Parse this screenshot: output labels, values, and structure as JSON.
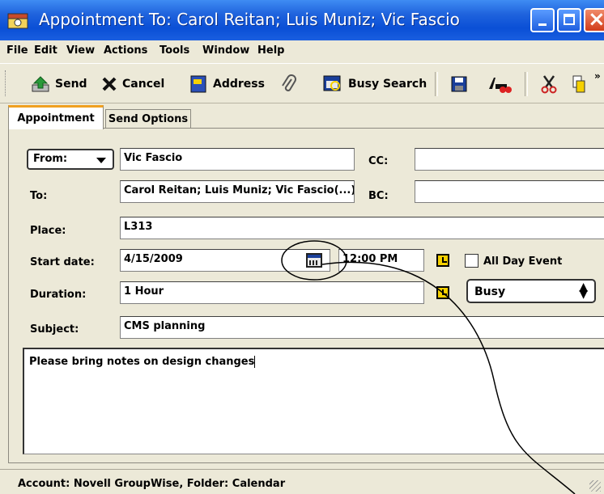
{
  "window": {
    "title": "Appointment To: Carol Reitan; Luis Muniz; Vic Fascio"
  },
  "menu": [
    "File",
    "Edit",
    "View",
    "Actions",
    "Tools",
    "Window",
    "Help"
  ],
  "toolbar": {
    "send_label": "Send",
    "cancel_label": "Cancel",
    "address_label": "Address",
    "busy_search_label": "Busy Search"
  },
  "tabs": [
    {
      "label": "Appointment",
      "active": true
    },
    {
      "label": "Send Options",
      "active": false
    }
  ],
  "form": {
    "from_label": "From:",
    "from_value": "Vic Fascio",
    "cc_label": "CC:",
    "cc_value": "",
    "to_label": "To:",
    "to_value": "Carol Reitan; Luis Muniz; Vic Fascio(...)",
    "bc_label": "BC:",
    "bc_value": "",
    "place_label": "Place:",
    "place_value": "L313",
    "start_date_label": "Start date:",
    "start_date_value": "4/15/2009",
    "start_time_value": "12:00 PM",
    "all_day_label": "All Day Event",
    "all_day_checked": false,
    "duration_label": "Duration:",
    "duration_value": "1 Hour",
    "show_as_value": "Busy",
    "subject_label": "Subject:",
    "subject_value": "CMS planning",
    "message_value": "Please bring notes on design changes"
  },
  "status": {
    "text": "Account: Novell GroupWise,  Folder: Calendar"
  },
  "colors": {
    "titlebar": "#1f63dd",
    "tab_accent": "#f0a020",
    "close_button": "#d23c1b"
  }
}
